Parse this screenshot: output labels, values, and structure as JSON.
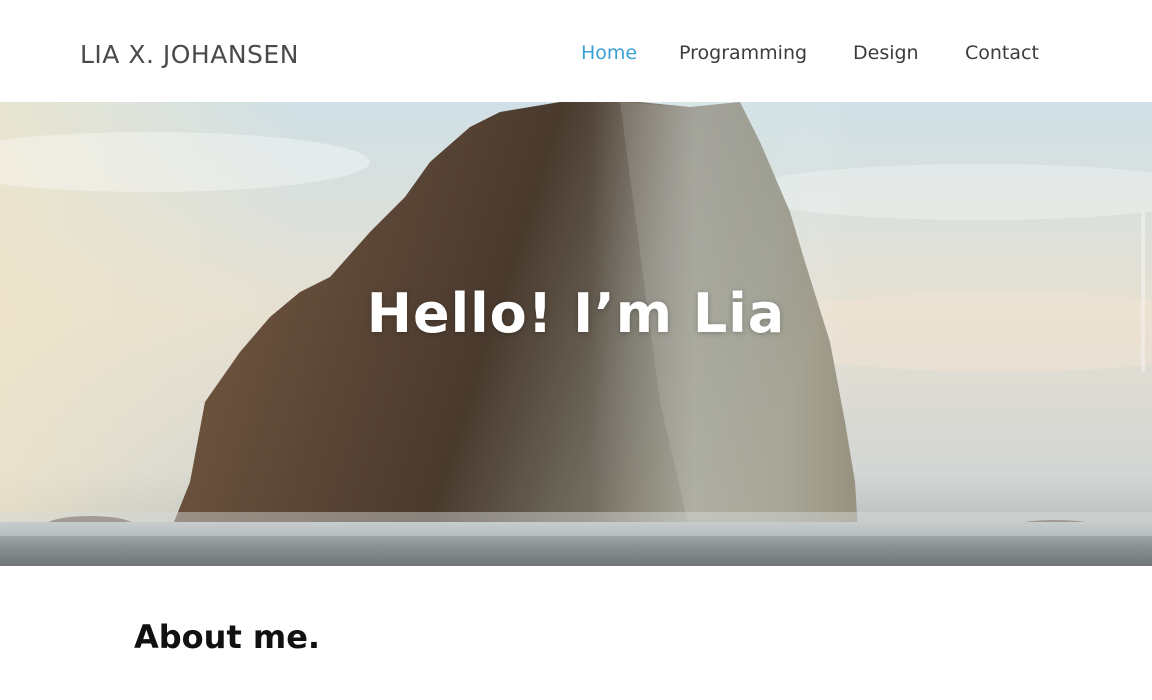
{
  "header": {
    "brand": "LIA X. JOHANSEN",
    "nav": [
      {
        "label": "Home",
        "active": true
      },
      {
        "label": "Programming",
        "active": false
      },
      {
        "label": "Design",
        "active": false
      },
      {
        "label": "Contact",
        "active": false
      }
    ]
  },
  "hero": {
    "title": "Hello! I’m Lia"
  },
  "about": {
    "heading": "About me."
  },
  "colors": {
    "accent": "#3aa0d6",
    "nav_text": "#3c3c3c",
    "brand_text": "#4a4a4a"
  }
}
